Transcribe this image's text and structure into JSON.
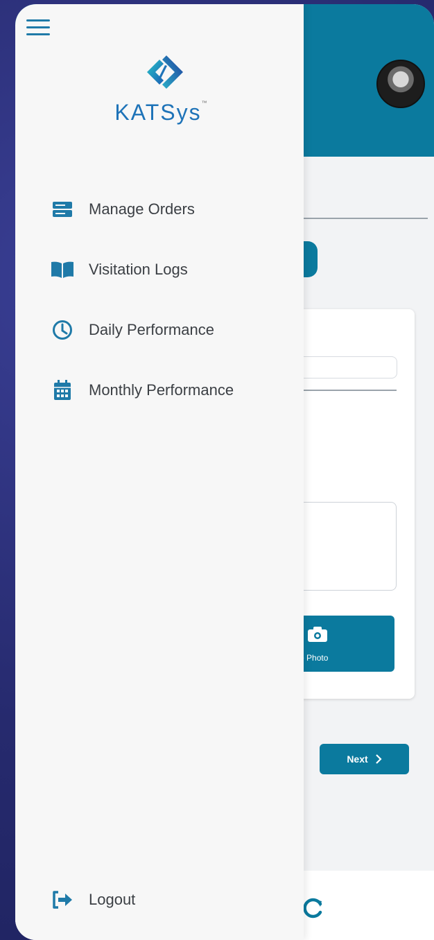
{
  "brand": {
    "name": "KATSys",
    "accent": "#0b7a9e"
  },
  "drawer": {
    "items": [
      {
        "label": "Manage Orders",
        "icon": "server-icon"
      },
      {
        "label": "Visitation Logs",
        "icon": "book-open-icon"
      },
      {
        "label": "Daily Performance",
        "icon": "clock-icon"
      },
      {
        "label": "Monthly Performance",
        "icon": "calendar-icon"
      }
    ],
    "logout_label": "Logout"
  },
  "background": {
    "capture_label": "ture Photo",
    "next_label": "Next"
  }
}
